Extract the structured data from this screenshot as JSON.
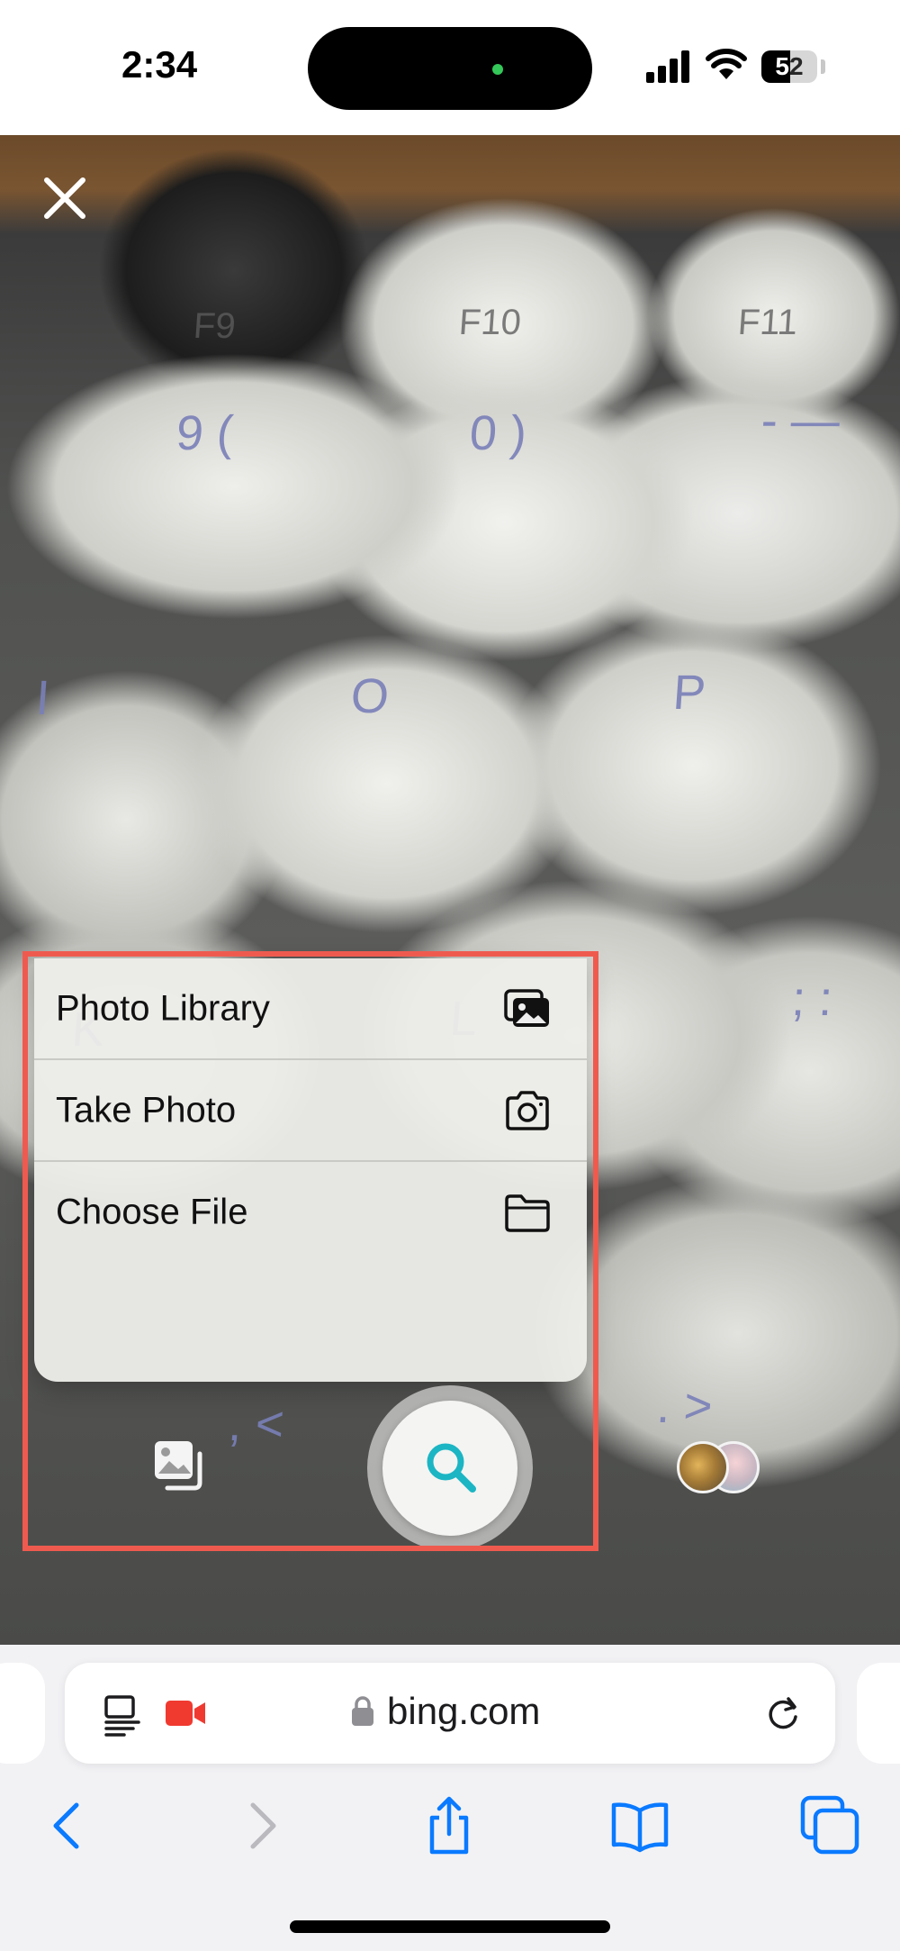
{
  "status_bar": {
    "time": "2:34",
    "battery": "52",
    "battery_level": 0.52
  },
  "camera": {
    "key_legends": [
      "F9",
      "F10",
      "F11",
      "9 (",
      "0 )",
      "- —",
      "I",
      "O",
      "P",
      "K",
      "L",
      "; :",
      ", <",
      ". >"
    ]
  },
  "menu": {
    "items": [
      {
        "label": "Photo Library",
        "icon": "photo-library-icon"
      },
      {
        "label": "Take Photo",
        "icon": "camera-icon"
      },
      {
        "label": "Choose File",
        "icon": "folder-icon"
      }
    ]
  },
  "controls": {
    "shutter_icon": "search-icon",
    "accent": "#1cb5c4",
    "highlight_color": "#ef5a4f"
  },
  "browser": {
    "url": "bing.com",
    "accent": "#0a7aff"
  }
}
